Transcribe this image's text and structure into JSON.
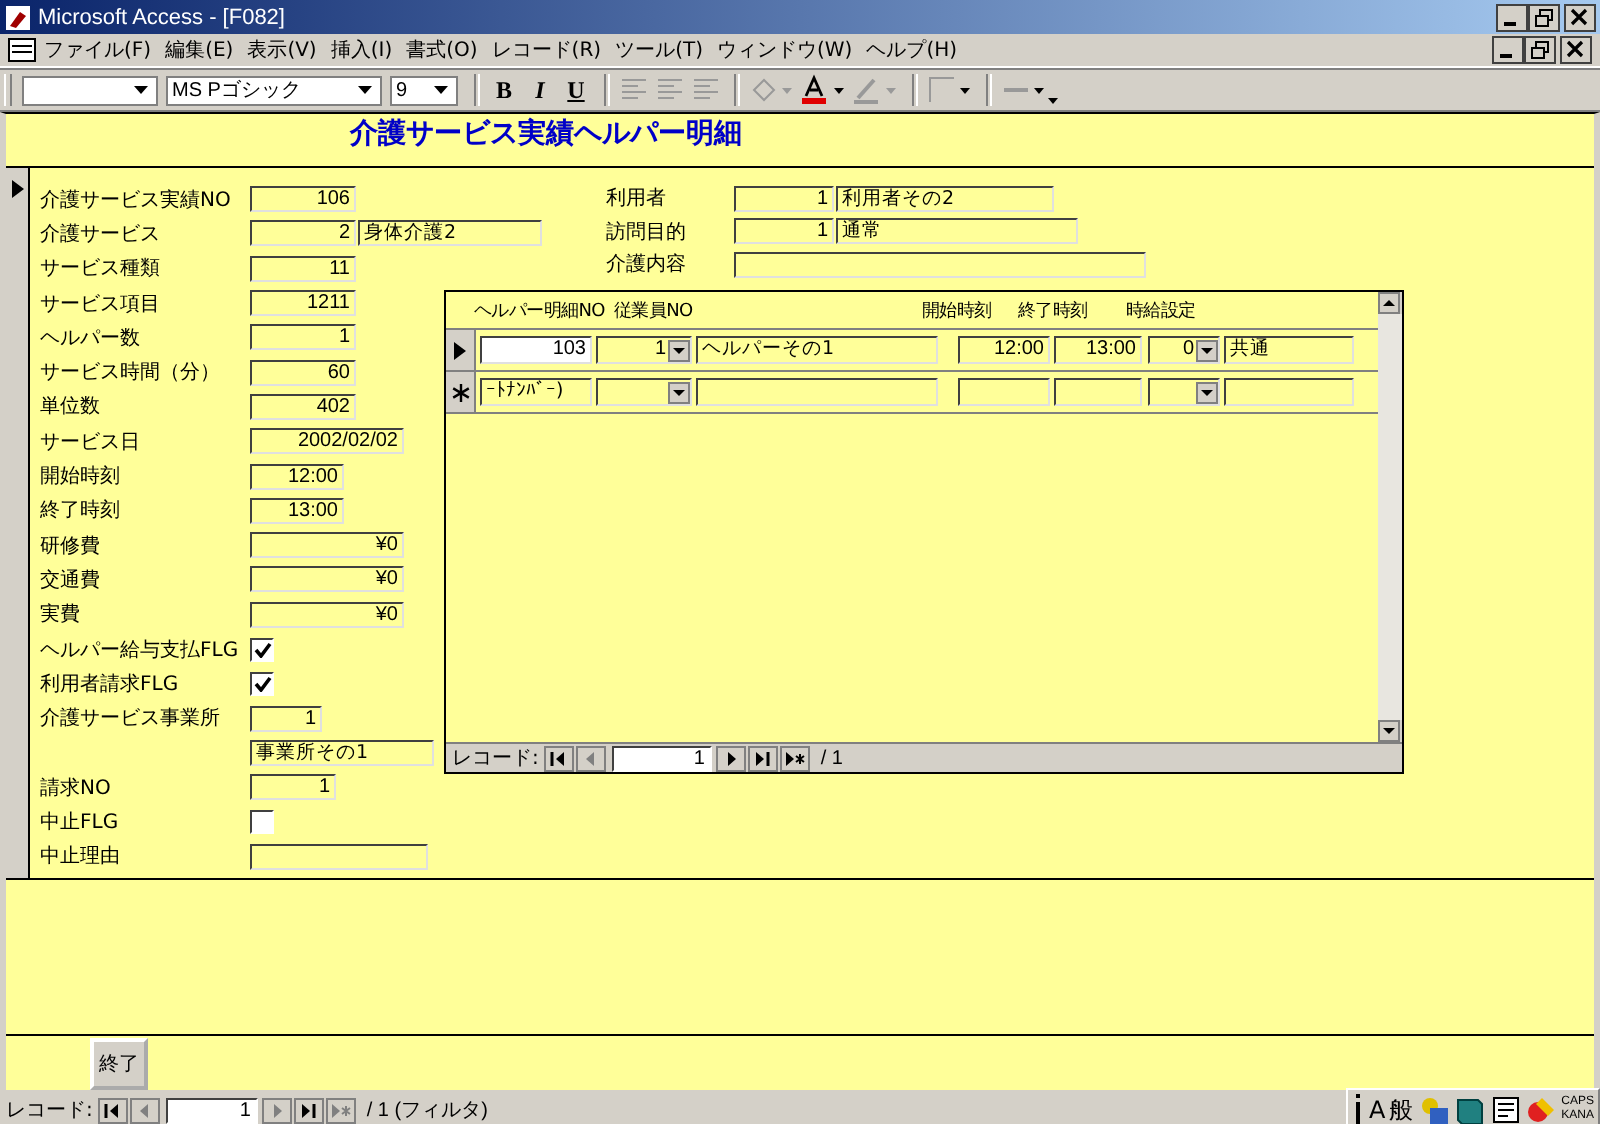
{
  "window": {
    "title": "Microsoft Access - [F082]"
  },
  "menu": [
    "ファイル(F)",
    "編集(E)",
    "表示(V)",
    "挿入(I)",
    "書式(O)",
    "レコード(R)",
    "ツール(T)",
    "ウィンドウ(W)",
    "ヘルプ(H)"
  ],
  "toolbar": {
    "font_name": "MS Pゴシック",
    "font_size": "9",
    "bold": "B",
    "italic": "I",
    "underline": "U"
  },
  "form": {
    "title": "介護サービス実績ヘルパー明細",
    "left_fields": [
      {
        "kind": "text",
        "label": "介護サービス実績NO",
        "values": [
          "106"
        ]
      },
      {
        "kind": "text",
        "label": "介護サービス",
        "values": [
          "2",
          "身体介護2"
        ]
      },
      {
        "kind": "text",
        "label": "サービス種類",
        "values": [
          "11"
        ]
      },
      {
        "kind": "text",
        "label": "サービス項目",
        "values": [
          "1211"
        ]
      },
      {
        "kind": "text",
        "label": "ヘルパー数",
        "values": [
          "1"
        ]
      },
      {
        "kind": "text",
        "label": "サービス時間（分）",
        "values": [
          "60"
        ]
      },
      {
        "kind": "text",
        "label": "単位数",
        "values": [
          "402"
        ]
      },
      {
        "kind": "text",
        "label": "サービス日",
        "values": [
          "2002/02/02"
        ]
      },
      {
        "kind": "text",
        "label": "開始時刻",
        "values": [
          "12:00"
        ]
      },
      {
        "kind": "text",
        "label": "終了時刻",
        "values": [
          "13:00"
        ]
      },
      {
        "kind": "text",
        "label": "研修費",
        "values": [
          "¥0"
        ]
      },
      {
        "kind": "text",
        "label": "交通費",
        "values": [
          "¥0"
        ]
      },
      {
        "kind": "text",
        "label": "実費",
        "values": [
          "¥0"
        ]
      },
      {
        "kind": "check",
        "label": "ヘルパー給与支払FLG",
        "checked": true
      },
      {
        "kind": "check",
        "label": "利用者請求FLG",
        "checked": true
      },
      {
        "kind": "text",
        "label": "介護サービス事業所",
        "values": [
          "1"
        ]
      },
      {
        "kind": "text",
        "values": [
          "事業所その1"
        ]
      },
      {
        "kind": "text",
        "label": "請求NO",
        "values": [
          "1"
        ]
      },
      {
        "kind": "check",
        "label": "中止FLG",
        "checked": false
      },
      {
        "kind": "text",
        "label": "中止理由"
      }
    ],
    "right_fields": [
      {
        "label": "利用者",
        "values": [
          "1",
          "利用者その2"
        ]
      },
      {
        "label": "訪問目的",
        "values": [
          "1",
          "通常"
        ]
      },
      {
        "label": "介護内容"
      }
    ],
    "subform": {
      "columns": [
        "ヘルパー明細NO",
        "従業員NO",
        "開始時刻",
        "終了時刻",
        "時給設定"
      ],
      "rows": [
        {
          "kind": "current",
          "cells": [
            "103",
            "1",
            "ヘルパーその1",
            "12:00",
            "13:00",
            "0",
            "共通"
          ]
        },
        {
          "kind": "new",
          "cells": [
            "ｰﾄﾅﾝﾊﾞｰ)",
            "",
            "",
            "",
            "",
            "",
            ""
          ]
        }
      ],
      "navigation": {
        "label": "レコード:",
        "record": "1",
        "total": "/ 1"
      }
    },
    "close_button": "終了"
  },
  "status_bar": {
    "label": "レコード:",
    "record": "1",
    "total": "/ 1 (フィルタ)",
    "ime": [
      "A",
      "般"
    ],
    "indicators": [
      "CAPS",
      "KANA"
    ]
  }
}
